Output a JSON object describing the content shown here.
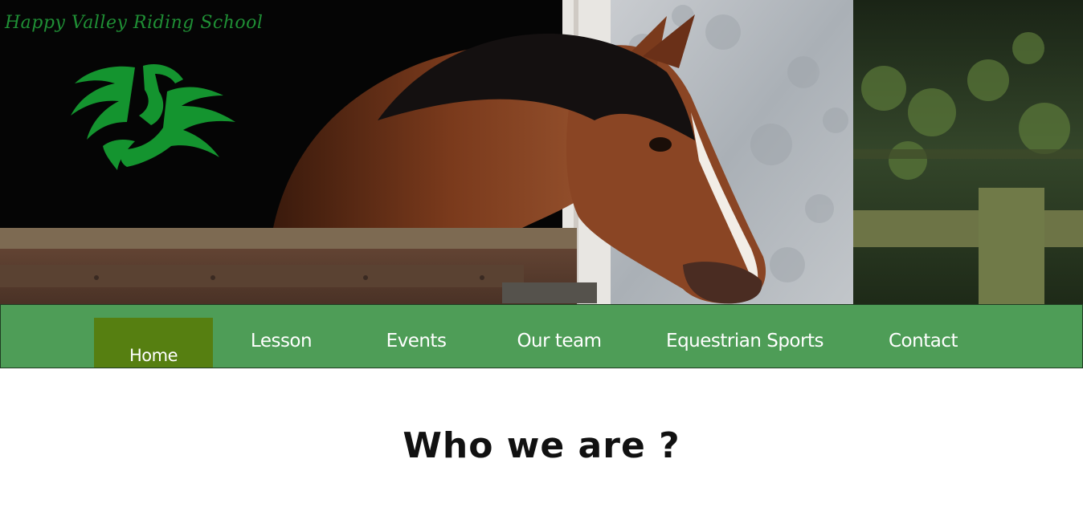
{
  "site": {
    "logo_text": "Happy Valley Riding School"
  },
  "hero": {
    "image": "horse-in-stable-door",
    "logo_icon": "green-horse-head-logo"
  },
  "nav": {
    "items": [
      {
        "label": "Home",
        "active": true
      },
      {
        "label": "Lesson",
        "active": false
      },
      {
        "label": "Events",
        "active": false
      },
      {
        "label": "Our team",
        "active": false
      },
      {
        "label": "Equestrian Sports",
        "active": false
      },
      {
        "label": "Contact",
        "active": false
      }
    ]
  },
  "main": {
    "heading": "Who we are ?"
  },
  "colors": {
    "nav_bg": "#4e9d57",
    "nav_active": "#567f11",
    "logo_green": "#1f8f35"
  }
}
